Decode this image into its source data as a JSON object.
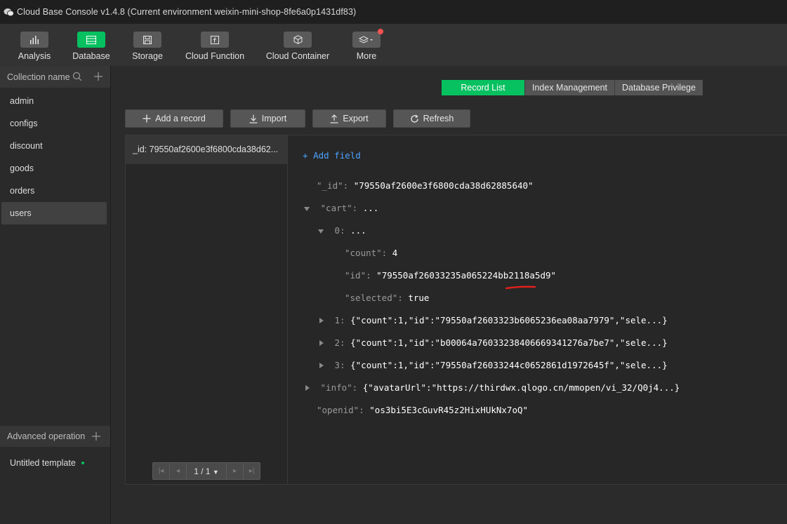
{
  "window": {
    "title": "Cloud Base Console v1.4.8 (Current environment weixin-mini-shop-8fe6a0p1431df83)"
  },
  "toolbar": {
    "items": [
      {
        "label": "Analysis",
        "icon": "bar-chart-icon"
      },
      {
        "label": "Database",
        "icon": "database-icon"
      },
      {
        "label": "Storage",
        "icon": "storage-icon"
      },
      {
        "label": "Cloud Function",
        "icon": "function-icon"
      },
      {
        "label": "Cloud Container",
        "icon": "container-icon"
      },
      {
        "label": "More",
        "icon": "layers-icon"
      }
    ],
    "accent_color": "#07c160"
  },
  "sidebar": {
    "header_label": "Collection name",
    "collections": [
      "admin",
      "configs",
      "discount",
      "goods",
      "orders",
      "users"
    ],
    "selected": "users",
    "advanced_label": "Advanced operation",
    "template_label": "Untitled template"
  },
  "tabs": [
    "Record List",
    "Index Management",
    "Database Privilege"
  ],
  "actions": {
    "add": "Add a record",
    "import": "Import",
    "export": "Export",
    "refresh": "Refresh"
  },
  "records": {
    "item": "_id: 79550af2600e3f6800cda38d62...",
    "pager": "1 / 1"
  },
  "document": {
    "add_field": "Add field",
    "id_key": "\"_id\":",
    "id_val": "\"79550af2600e3f6800cda38d62885640\"",
    "cart_key": "\"cart\":",
    "cart_val": "...",
    "item0_key": "0:",
    "item0_val": "...",
    "count_key": "\"count\":",
    "count_val": "4",
    "iid_key": "\"id\":",
    "iid_val": "\"79550af26033235a065224bb2118a5d9\"",
    "selected_key": "\"selected\":",
    "selected_val": "true",
    "item1_key": "1:",
    "item1_val": "{\"count\":1,\"id\":\"79550af2603323b6065236ea08aa7979\",\"sele...}",
    "item2_key": "2:",
    "item2_val": "{\"count\":1,\"id\":\"b00064a76033238406669341276a7be7\",\"sele...}",
    "item3_key": "3:",
    "item3_val": "{\"count\":1,\"id\":\"79550af26033244c0652861d1972645f\",\"sele...}",
    "info_key": "\"info\":",
    "info_val": "{\"avatarUrl\":\"https://thirdwx.qlogo.cn/mmopen/vi_32/Q0j4...}",
    "openid_key": "\"openid\":",
    "openid_val": "\"os3bi5E3cGuvR45z2HixHUkNx7oQ\""
  }
}
